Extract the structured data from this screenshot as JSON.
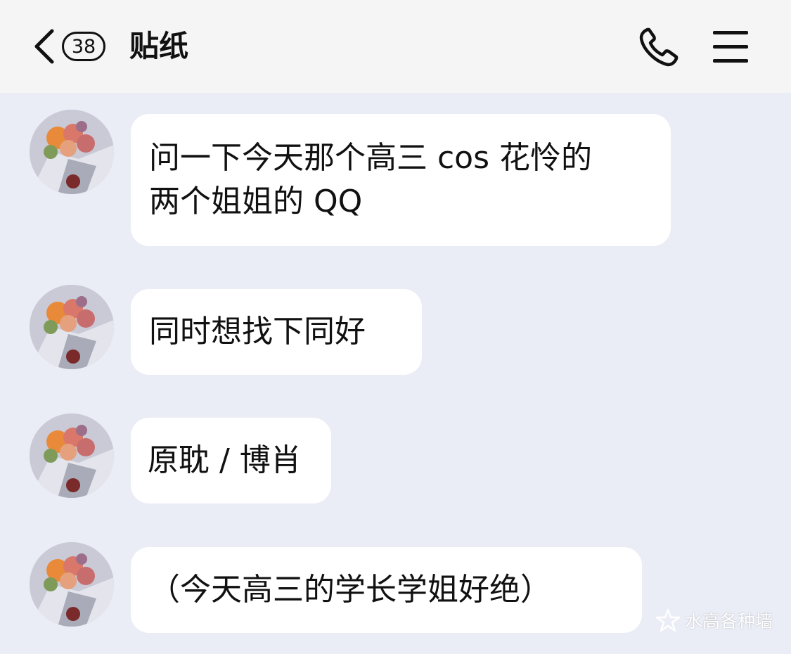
{
  "header": {
    "unread_count": "38",
    "title": "贴纸"
  },
  "messages": [
    {
      "lines": [
        "问一下今天那个高三 cos 花怜的",
        "两个姐姐的 QQ"
      ]
    },
    {
      "lines": [
        "同时想找下同好"
      ]
    },
    {
      "lines": [
        "原耽 / 博肖"
      ]
    },
    {
      "lines": [
        "（今天高三的学长学姐好绝）"
      ]
    }
  ],
  "watermark": {
    "text": "水高各种墙"
  },
  "icons": {
    "back": "chevron-left-icon",
    "call": "phone-icon",
    "menu": "hamburger-menu-icon",
    "avatar": "flower-bouquet-avatar",
    "watermark": "star-logo-icon"
  },
  "colors": {
    "background": "#ebedf6",
    "header_background": "#f5f5f6",
    "bubble": "#ffffff",
    "text": "#111111"
  }
}
